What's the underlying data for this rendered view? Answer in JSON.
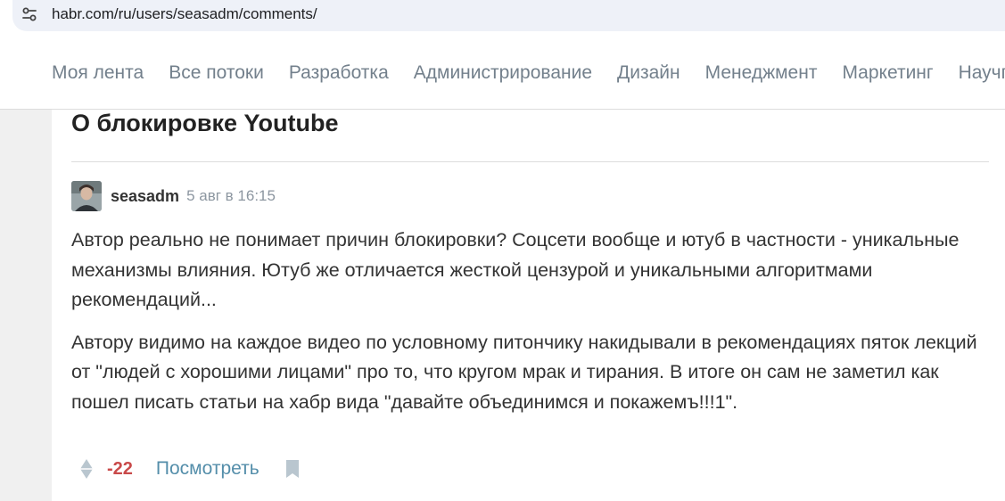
{
  "browser": {
    "url": "habr.com/ru/users/seasadm/comments/",
    "site_info_icon": "tune-icon"
  },
  "nav": {
    "items": [
      {
        "label": "Моя лента"
      },
      {
        "label": "Все потоки"
      },
      {
        "label": "Разработка"
      },
      {
        "label": "Администрирование"
      },
      {
        "label": "Дизайн"
      },
      {
        "label": "Менеджмент"
      },
      {
        "label": "Маркетинг"
      },
      {
        "label": "Научпоп"
      }
    ]
  },
  "article": {
    "title": "О блокировке Youtube"
  },
  "comment": {
    "author": "seasadm",
    "time": "5 авг в 16:15",
    "paragraphs": [
      "Автор реально не понимает причин блокировки? Соцсети вообще и ютуб в частности - уникальные механизмы влияния. Ютуб же отличается жесткой цензурой и уникальными алгоритмами рекомендаций...",
      "Автору видимо на каждое видео по условному питончику накидывали в рекомендациях пяток лекций от \"людей с хорошими лицами\" про то, что кругом мрак и тирания. В итоге он сам не заметил как пошел писать статьи на хабр вида \"давайте объединимся и покажемъ!!!1\"."
    ],
    "score": "-22",
    "view_label": "Посмотреть",
    "vote_icon": "vote-diamond-icon",
    "bookmark_icon": "bookmark-icon"
  },
  "colors": {
    "score_negative": "#c94a4a",
    "link": "#548eaa",
    "nav_text": "#73808c",
    "page_bg": "#f0f0f0"
  }
}
